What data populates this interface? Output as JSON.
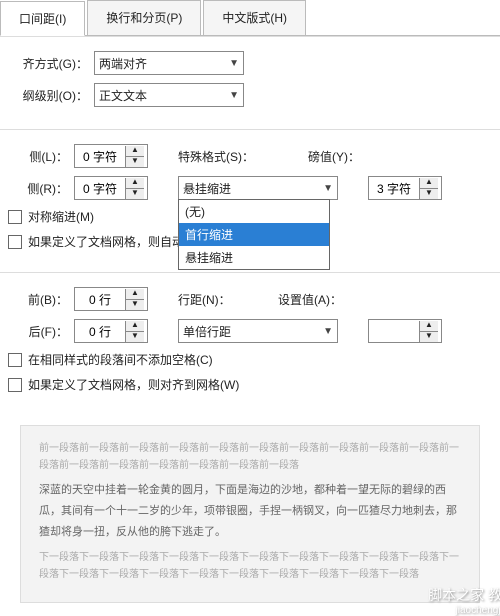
{
  "tabs": {
    "t1": "口间距(I)",
    "t2": "换行和分页(P)",
    "t3": "中文版式(H)"
  },
  "general": {
    "alignLabel": "齐方式(G)：",
    "alignValue": "两端对齐",
    "levelLabel": "纲级别(O)：",
    "levelValue": "正文文本"
  },
  "indent": {
    "leftLabel": "侧(L)：",
    "leftValue": "0 字符",
    "rightLabel": "侧(R)：",
    "rightValue": "0 字符",
    "specialLabel": "特殊格式(S)：",
    "specialValue": "悬挂缩进",
    "options": {
      "none": "(无)",
      "first": "首行缩进",
      "hang": "悬挂缩进"
    },
    "byLabel": "磅值(Y)：",
    "byValue": "3 字符",
    "mirror": "对称缩进(M)",
    "autoAdjust": "如果定义了文档网格，则自动调整右缩进"
  },
  "spacing": {
    "beforeLabel": "前(B)：",
    "beforeValue": "0 行",
    "afterLabel": "后(F)：",
    "afterValue": "0 行",
    "lineLabel": "行距(N)：",
    "lineValue": "单倍行距",
    "atLabel": "设置值(A)：",
    "atValue": "",
    "noSpace": "在相同样式的段落间不添加空格(C)",
    "snapGrid": "如果定义了文档网格，则对齐到网格(W)"
  },
  "preview": {
    "top": "前一段落前一段落前一段落前一段落前一段落前一段落前一段落前一段落前一段落前一段落前一段落前一段落前一段落前一段落前一段落前一段落前一段落",
    "body": "深蓝的天空中挂着一轮金黄的圆月，下面是海边的沙地，都种着一望无际的碧绿的西瓜，其间有一个十一二岁的少年，项带银圈，手捏一柄钢叉，向一匹猹尽力地刺去，那猹却将身一扭，反从他的胯下逃走了。",
    "bottom": "下一段落下一段落下一段落下一段落下一段落下一段落下一段落下一段落下一段落下一段落下一段落下一段落下一段落下一段落下一段落下一段落下一段落下一段落下一段落下一段落"
  },
  "wm": {
    "t1": "脚本之家 教程网",
    "t2": "jiaochengjia.com"
  }
}
